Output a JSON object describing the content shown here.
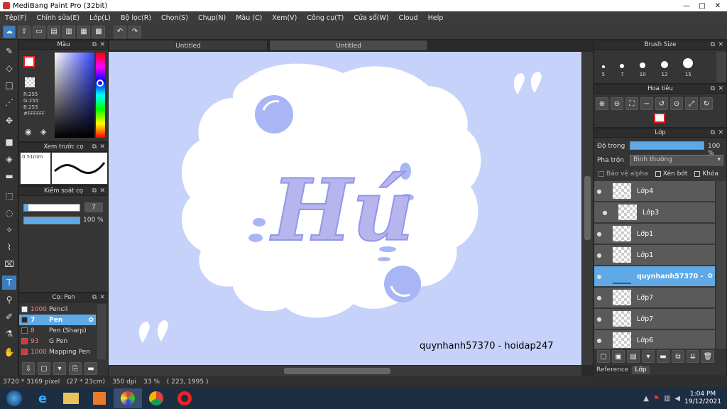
{
  "window": {
    "title": "MediBang Paint Pro (32bit)",
    "minimize": "—",
    "maximize": "□",
    "close": "✕"
  },
  "menu": [
    "Tệp(F)",
    "Chỉnh sửa(E)",
    "Lớp(L)",
    "Bộ lọc(R)",
    "Chọn(S)",
    "Chụp(N)",
    "Màu (C)",
    "Xem(V)",
    "Công cụ(T)",
    "Cửa sổ(W)",
    "Cloud",
    "Help"
  ],
  "toolbar": {
    "undo": "↶",
    "redo": "↷"
  },
  "color_panel": {
    "title": "Màu",
    "r": "R:255",
    "g": "G:255",
    "b": "B:255",
    "hex": "#FFFFFF"
  },
  "brush_preview": {
    "title": "Xem trước cọ",
    "size": "0.51mm"
  },
  "brush_control": {
    "title": "Kiểm soát cọ",
    "size_value": "7",
    "opacity_value": "100 %"
  },
  "brush_list": {
    "title": "Cọ: Pen",
    "items": [
      {
        "size": "1000",
        "name": "Pencil",
        "color": "#f2f2f2"
      },
      {
        "size": "7",
        "name": "Pen",
        "color": "#2b2b2b",
        "selected": true
      },
      {
        "size": "8",
        "name": "Pen (Sharp)",
        "color": "#2b2b2b"
      },
      {
        "size": "93",
        "name": "G Pen",
        "color": "#e53030"
      },
      {
        "size": "1000",
        "name": "Mapping Pen",
        "color": "#e53030"
      }
    ]
  },
  "tabs": [
    "Untitled",
    "Untitled"
  ],
  "artwork": {
    "title_text": "Hú",
    "watermark": "quynhanh57370 - hoidap247",
    "quote_mark": "“”"
  },
  "brush_size": {
    "title": "Brush Size",
    "sizes": [
      "5",
      "7",
      "10",
      "12",
      "15"
    ]
  },
  "navigator": {
    "title": "Hoa tiêu"
  },
  "layers": {
    "title": "Lớp",
    "opacity_label": "Độ trong",
    "opacity_value": "100 %",
    "blend_label": "Pha trộn",
    "blend_value": "Bình thường",
    "protect_alpha": "Bảo vệ alpha",
    "clipping": "Xén bớt",
    "lock": "Khóa",
    "items": [
      {
        "name": "Lớp4",
        "indent": false,
        "selected": false
      },
      {
        "name": "Lớp3",
        "indent": true,
        "selected": false
      },
      {
        "name": "Lớp1",
        "indent": false,
        "selected": false
      },
      {
        "name": "Lớp1",
        "indent": false,
        "selected": false
      },
      {
        "name": "quynhanh57370 -",
        "indent": false,
        "selected": true
      },
      {
        "name": "Lớp7",
        "indent": false,
        "selected": false
      },
      {
        "name": "Lớp7",
        "indent": false,
        "selected": false
      },
      {
        "name": "Lớp6",
        "indent": false,
        "selected": false
      }
    ],
    "bottom_tabs": [
      "Reference",
      "Lớp"
    ]
  },
  "status": {
    "pixels": "3720 * 3169 pixel",
    "cm": "(27 * 23cm)",
    "dpi": "350 dpi",
    "zoom": "33 %",
    "coords": "( 223, 1995 )"
  },
  "taskbar": {
    "time": "1:04 PM",
    "date": "19/12/2021"
  }
}
